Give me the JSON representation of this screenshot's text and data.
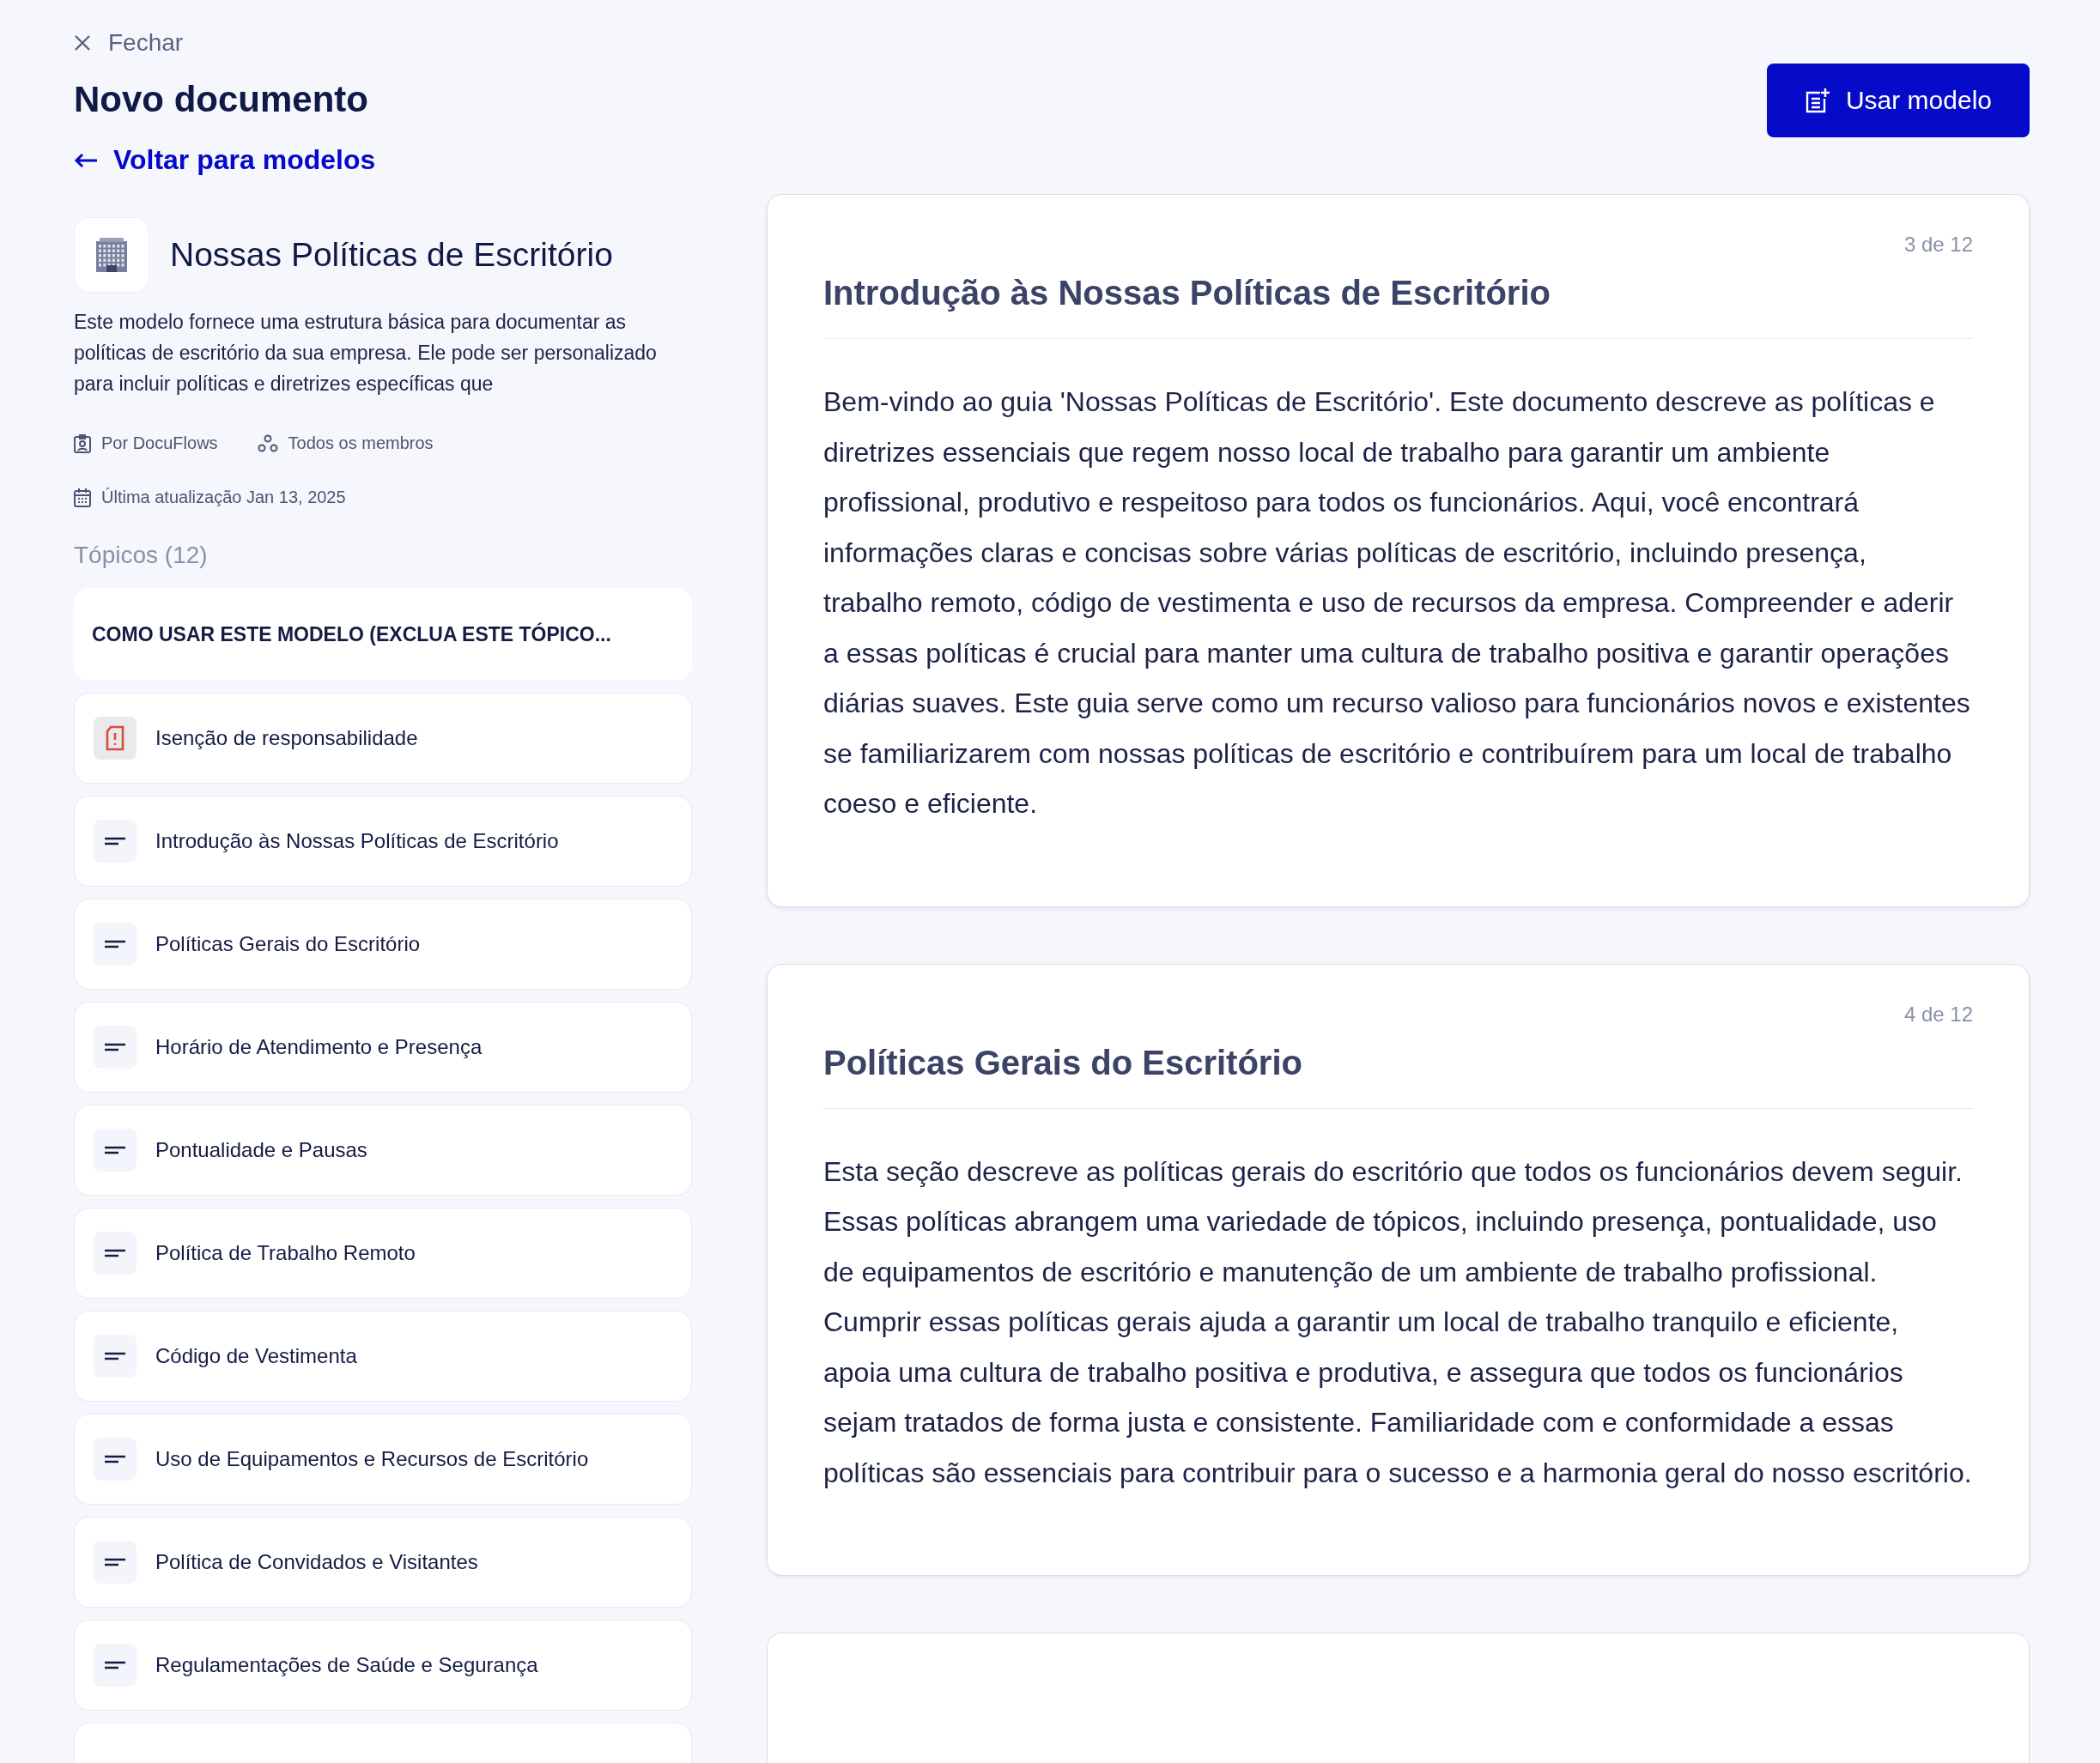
{
  "close": {
    "label": "Fechar"
  },
  "page_title": "Novo documento",
  "back_link": "Voltar para modelos",
  "use_button": "Usar modelo",
  "template": {
    "title": "Nossas Políticas de Escritório",
    "description": "Este modelo fornece uma estrutura básica para documentar as políticas de escritório da sua empresa. Ele pode ser personalizado para incluir políticas e diretrizes específicas que",
    "meta": [
      {
        "kind": "author",
        "text": "Por DocuFlows"
      },
      {
        "kind": "audience",
        "text": "Todos os membros"
      },
      {
        "kind": "date",
        "text": "Última atualização Jan 13, 2025"
      }
    ]
  },
  "topics_heading": "Tópicos (12)",
  "topics": [
    {
      "kind": "header",
      "label": "COMO USAR ESTE MODELO (EXCLUA ESTE TÓPICO..."
    },
    {
      "kind": "warning",
      "label": "Isenção de responsabilidade"
    },
    {
      "kind": "text",
      "label": "Introdução às Nossas Políticas de Escritório"
    },
    {
      "kind": "text",
      "label": "Políticas Gerais do Escritório"
    },
    {
      "kind": "text",
      "label": "Horário de Atendimento e Presença"
    },
    {
      "kind": "text",
      "label": "Pontualidade e Pausas"
    },
    {
      "kind": "text",
      "label": "Política de Trabalho Remoto"
    },
    {
      "kind": "text",
      "label": "Código de Vestimenta"
    },
    {
      "kind": "text",
      "label": "Uso de Equipamentos e Recursos de Escritório"
    },
    {
      "kind": "text",
      "label": "Política de Convidados e Visitantes"
    },
    {
      "kind": "text",
      "label": "Regulamentações de Saúde e Segurança"
    }
  ],
  "sections": [
    {
      "counter": "3 de 12",
      "title": "Introdução às Nossas Políticas de Escritório",
      "body": "Bem-vindo ao guia 'Nossas Políticas de Escritório'. Este documento descreve as políticas e diretrizes essenciais que regem nosso local de trabalho para garantir um ambiente profissional, produtivo e respeitoso para todos os funcionários. Aqui, você encontrará informações claras e concisas sobre várias políticas de escritório, incluindo presença, trabalho remoto, código de vestimenta e uso de recursos da empresa. Compreender e aderir a essas políticas é crucial para manter uma cultura de trabalho positiva e garantir operações diárias suaves. Este guia serve como um recurso valioso para funcionários novos e existentes se familiarizarem com nossas políticas de escritório e contribuírem para um local de trabalho coeso e eficiente."
    },
    {
      "counter": "4 de 12",
      "title": "Políticas Gerais do Escritório",
      "body": "Esta seção descreve as políticas gerais do escritório que todos os funcionários devem seguir. Essas políticas abrangem uma variedade de tópicos, incluindo presença, pontualidade, uso de equipamentos de escritório e manutenção de um ambiente de trabalho profissional. Cumprir essas políticas gerais ajuda a garantir um local de trabalho tranquilo e eficiente, apoia uma cultura de trabalho positiva e produtiva, e assegura que todos os funcionários sejam tratados de forma justa e consistente. Familiaridade com e conformidade a essas políticas são essenciais para contribuir para o sucesso e a harmonia geral do nosso escritório."
    }
  ]
}
